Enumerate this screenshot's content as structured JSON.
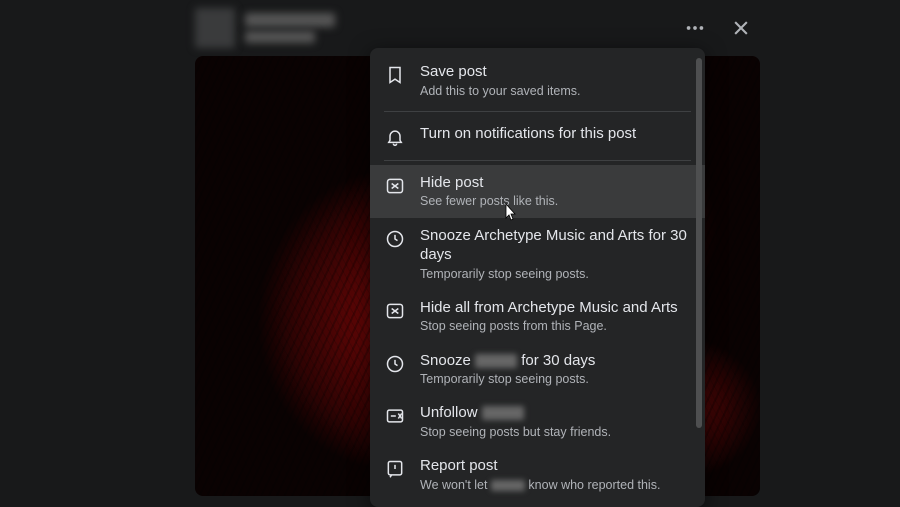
{
  "menu": {
    "save": {
      "title": "Save post",
      "sub": "Add this to your saved items."
    },
    "notify": {
      "title": "Turn on notifications for this post"
    },
    "hide": {
      "title": "Hide post",
      "sub": "See fewer posts like this."
    },
    "snooze_page": {
      "title": "Snooze Archetype Music and Arts for 30 days",
      "sub": "Temporarily stop seeing posts."
    },
    "hide_all": {
      "title": "Hide all from Archetype Music and Arts",
      "sub": "Stop seeing posts from this Page."
    },
    "snooze_user": {
      "prefix": "Snooze ",
      "suffix": " for 30 days",
      "sub": "Temporarily stop seeing posts."
    },
    "unfollow": {
      "prefix": "Unfollow ",
      "sub": "Stop seeing posts but stay friends."
    },
    "report": {
      "title": "Report post",
      "sub_prefix": "We won't let ",
      "sub_suffix": " know who reported this."
    }
  }
}
